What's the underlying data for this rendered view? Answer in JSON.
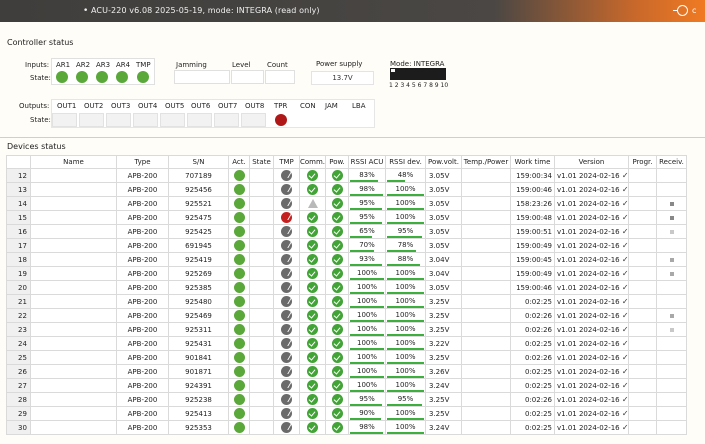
{
  "title": "ACU-220 v6.08 2025-05-19, mode: INTEGRA (read only)",
  "title_right": "c",
  "controller_status": {
    "heading": "Controller status",
    "inputs_label": "Inputs:",
    "state_label": "State:",
    "inputs": [
      "AR1",
      "AR2",
      "AR3",
      "AR4",
      "TMP"
    ],
    "jamming_label": "Jamming",
    "level_label": "Level",
    "count_label": "Count",
    "power_label": "Power supply",
    "power_value": "13.7V",
    "mode_label": "Mode: INTEGRA",
    "dip_numbers": "1 2 3 4 5 6 7 8 9 10",
    "outputs_label": "Outputs:",
    "outputs": [
      "OUT1",
      "OUT2",
      "OUT3",
      "OUT4",
      "OUT5",
      "OUT6",
      "OUT7",
      "OUT8",
      "TPR",
      "CON",
      "JAM",
      "LBA"
    ]
  },
  "devices_status": {
    "heading": "Devices status",
    "columns": [
      "",
      "Name",
      "Type",
      "S/N",
      "Act.",
      "State",
      "TMP",
      "Comm.",
      "Pow.",
      "RSSI ACU",
      "RSSI dev.",
      "Pow.volt.",
      "Temp./Power",
      "Work time",
      "Version",
      "Progr.",
      "Receiv."
    ],
    "rows": [
      {
        "idx": "12",
        "type": "APB-200",
        "sn": "707189",
        "tmp": "gray",
        "comm": "ok",
        "pow": "ok",
        "rssi_acu": "83%",
        "rssi_dev": "48%",
        "volt": "3.05V",
        "work": "159:00:34",
        "version": "v1.01 2024-02-16",
        "check": "✓",
        "recv": ""
      },
      {
        "idx": "13",
        "type": "APB-200",
        "sn": "925456",
        "tmp": "gray",
        "comm": "ok",
        "pow": "ok",
        "rssi_acu": "98%",
        "rssi_dev": "100%",
        "volt": "3.05V",
        "work": "159:00:46",
        "version": "v1.01 2024-02-16",
        "check": "✓",
        "recv": ""
      },
      {
        "idx": "14",
        "type": "APB-200",
        "sn": "925521",
        "tmp": "gray",
        "comm": "warn",
        "pow": "ok",
        "rssi_acu": "95%",
        "rssi_dev": "100%",
        "volt": "3.05V",
        "work": "158:23:26",
        "version": "v1.01 2024-02-16",
        "check": "✓",
        "recv": "dark"
      },
      {
        "idx": "15",
        "type": "APB-200",
        "sn": "925475",
        "tmp": "red",
        "comm": "ok",
        "pow": "ok",
        "rssi_acu": "95%",
        "rssi_dev": "100%",
        "volt": "3.05V",
        "work": "159:00:48",
        "version": "v1.01 2024-02-16",
        "check": "✓",
        "recv": "dark"
      },
      {
        "idx": "16",
        "type": "APB-200",
        "sn": "925425",
        "tmp": "gray",
        "comm": "ok",
        "pow": "ok",
        "rssi_acu": "65%",
        "rssi_dev": "95%",
        "volt": "3.05V",
        "work": "159:00:51",
        "version": "v1.01 2024-02-16",
        "check": "✓",
        "recv": "light"
      },
      {
        "idx": "17",
        "type": "APB-200",
        "sn": "691945",
        "tmp": "gray",
        "comm": "ok",
        "pow": "ok",
        "rssi_acu": "70%",
        "rssi_dev": "78%",
        "volt": "3.05V",
        "work": "159:00:49",
        "version": "v1.01 2024-02-16",
        "check": "✓",
        "recv": ""
      },
      {
        "idx": "18",
        "type": "APB-200",
        "sn": "925419",
        "tmp": "gray",
        "comm": "ok",
        "pow": "ok",
        "rssi_acu": "93%",
        "rssi_dev": "88%",
        "volt": "3.04V",
        "work": "159:00:45",
        "version": "v1.01 2024-02-16",
        "check": "✓",
        "recv": "mid"
      },
      {
        "idx": "19",
        "type": "APB-200",
        "sn": "925269",
        "tmp": "gray",
        "comm": "ok",
        "pow": "ok",
        "rssi_acu": "100%",
        "rssi_dev": "100%",
        "volt": "3.04V",
        "work": "159:00:49",
        "version": "v1.01 2024-02-16",
        "check": "✓",
        "recv": "mid"
      },
      {
        "idx": "20",
        "type": "APB-200",
        "sn": "925385",
        "tmp": "gray",
        "comm": "ok",
        "pow": "ok",
        "rssi_acu": "100%",
        "rssi_dev": "100%",
        "volt": "3.05V",
        "work": "159:00:46",
        "version": "v1.01 2024-02-16",
        "check": "✓",
        "recv": ""
      },
      {
        "idx": "21",
        "type": "APB-200",
        "sn": "925480",
        "tmp": "gray",
        "comm": "ok",
        "pow": "ok",
        "rssi_acu": "100%",
        "rssi_dev": "100%",
        "volt": "3.25V",
        "work": "0:02:25",
        "version": "v1.01 2024-02-16",
        "check": "✓",
        "recv": ""
      },
      {
        "idx": "22",
        "type": "APB-200",
        "sn": "925469",
        "tmp": "gray",
        "comm": "ok",
        "pow": "ok",
        "rssi_acu": "100%",
        "rssi_dev": "100%",
        "volt": "3.25V",
        "work": "0:02:26",
        "version": "v1.01 2024-02-16",
        "check": "✓",
        "recv": "mid"
      },
      {
        "idx": "23",
        "type": "APB-200",
        "sn": "925311",
        "tmp": "gray",
        "comm": "ok",
        "pow": "ok",
        "rssi_acu": "100%",
        "rssi_dev": "100%",
        "volt": "3.25V",
        "work": "0:02:26",
        "version": "v1.01 2024-02-16",
        "check": "✓",
        "recv": "light"
      },
      {
        "idx": "24",
        "type": "APB-200",
        "sn": "925431",
        "tmp": "gray",
        "comm": "ok",
        "pow": "ok",
        "rssi_acu": "100%",
        "rssi_dev": "100%",
        "volt": "3.22V",
        "work": "0:02:25",
        "version": "v1.01 2024-02-16",
        "check": "✓",
        "recv": ""
      },
      {
        "idx": "25",
        "type": "APB-200",
        "sn": "901841",
        "tmp": "gray",
        "comm": "ok",
        "pow": "ok",
        "rssi_acu": "100%",
        "rssi_dev": "100%",
        "volt": "3.25V",
        "work": "0:02:26",
        "version": "v1.01 2024-02-16",
        "check": "✓",
        "recv": ""
      },
      {
        "idx": "26",
        "type": "APB-200",
        "sn": "901871",
        "tmp": "gray",
        "comm": "ok",
        "pow": "ok",
        "rssi_acu": "100%",
        "rssi_dev": "100%",
        "volt": "3.26V",
        "work": "0:02:25",
        "version": "v1.01 2024-02-16",
        "check": "✓",
        "recv": ""
      },
      {
        "idx": "27",
        "type": "APB-200",
        "sn": "924391",
        "tmp": "gray",
        "comm": "ok",
        "pow": "ok",
        "rssi_acu": "100%",
        "rssi_dev": "100%",
        "volt": "3.24V",
        "work": "0:02:25",
        "version": "v1.01 2024-02-16",
        "check": "✓",
        "recv": ""
      },
      {
        "idx": "28",
        "type": "APB-200",
        "sn": "925238",
        "tmp": "gray",
        "comm": "ok",
        "pow": "ok",
        "rssi_acu": "95%",
        "rssi_dev": "95%",
        "volt": "3.25V",
        "work": "0:02:26",
        "version": "v1.01 2024-02-16",
        "check": "✓",
        "recv": ""
      },
      {
        "idx": "29",
        "type": "APB-200",
        "sn": "925413",
        "tmp": "gray",
        "comm": "ok",
        "pow": "ok",
        "rssi_acu": "90%",
        "rssi_dev": "100%",
        "volt": "3.25V",
        "work": "0:02:25",
        "version": "v1.01 2024-02-16",
        "check": "✓",
        "recv": ""
      },
      {
        "idx": "30",
        "type": "APB-200",
        "sn": "925353",
        "tmp": "gray",
        "comm": "ok",
        "pow": "ok",
        "rssi_acu": "98%",
        "rssi_dev": "100%",
        "volt": "3.24V",
        "work": "0:02:25",
        "version": "v1.01 2024-02-16",
        "check": "✓",
        "recv": ""
      }
    ]
  }
}
